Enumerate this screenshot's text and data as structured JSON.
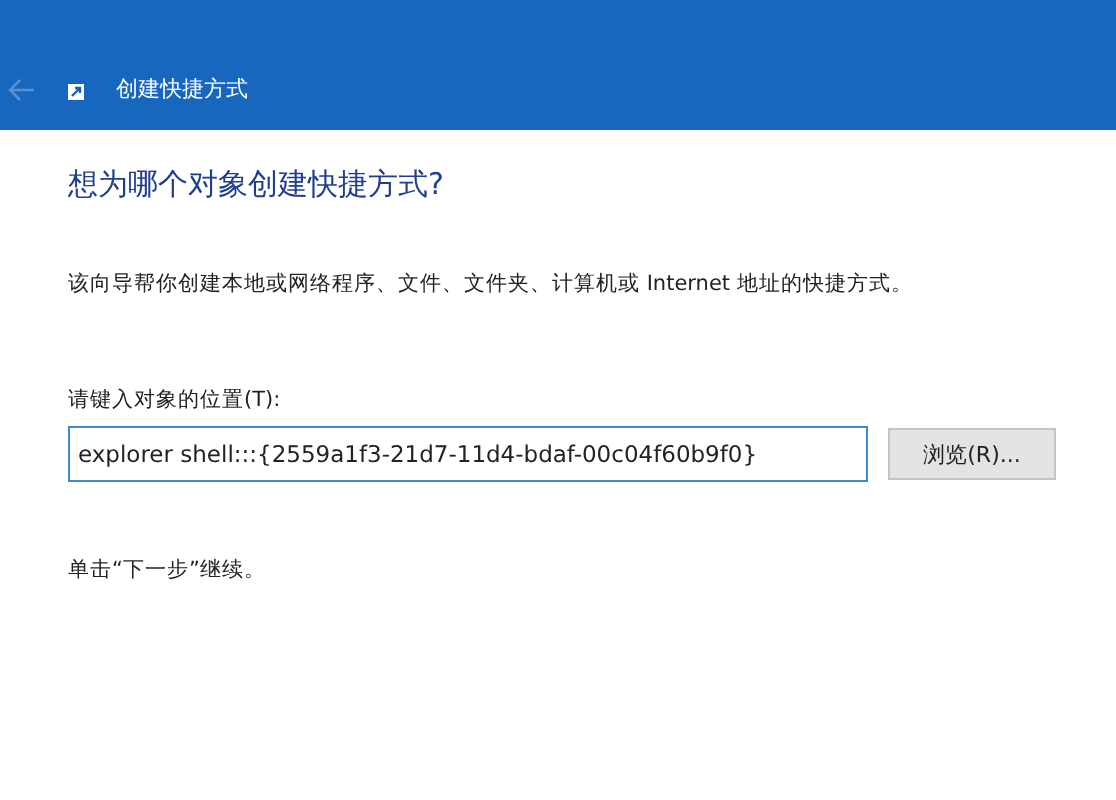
{
  "window": {
    "title": "创建快捷方式"
  },
  "heading": "想为哪个对象创建快捷方式?",
  "description": "该向导帮你创建本地或网络程序、文件、文件夹、计算机或 Internet 地址的快捷方式。",
  "location": {
    "label": "请键入对象的位置(T):",
    "value": "explorer shell:::{2559a1f3-21d7-11d4-bdaf-00c04f60b9f0}"
  },
  "browse_button": "浏览(R)...",
  "hint": "单击“下一步”继续。"
}
